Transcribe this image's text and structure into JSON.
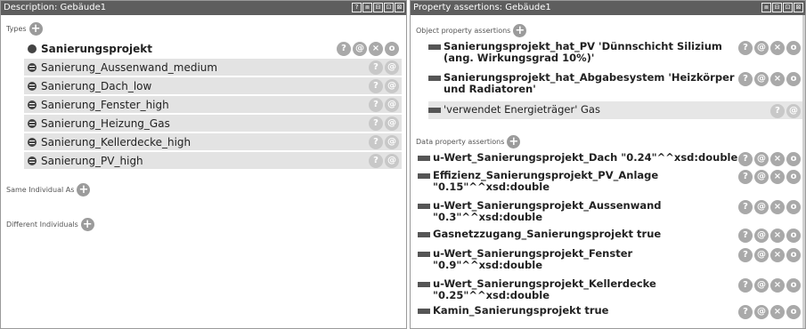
{
  "left": {
    "title": "Description: Gebäude1",
    "titlebar_buttons": [
      "?",
      "⧈",
      "⊟",
      "⊡",
      "⊠"
    ],
    "types_label": "Types",
    "types": [
      {
        "label": "Sanierungsprojekt",
        "kind": "dot",
        "bold": true
      },
      {
        "label": "Sanierung_Aussenwand_medium",
        "kind": "eq"
      },
      {
        "label": "Sanierung_Dach_low",
        "kind": "eq"
      },
      {
        "label": "Sanierung_Fenster_high",
        "kind": "eq"
      },
      {
        "label": "Sanierung_Heizung_Gas",
        "kind": "eq"
      },
      {
        "label": "Sanierung_Kellerdecke_high",
        "kind": "eq"
      },
      {
        "label": "Sanierung_PV_high",
        "kind": "eq"
      }
    ],
    "same_label": "Same Individual As",
    "different_label": "Different Individuals"
  },
  "right": {
    "title": "Property assertions: Gebäude1",
    "titlebar_buttons": [
      "⧈",
      "⊟",
      "⊡",
      "⊠"
    ],
    "object_label": "Object property assertions",
    "object_props": [
      {
        "line1": "Sanierungsprojekt_hat_PV  'Dünnschicht Silizium",
        "line2": "(ang. Wirkungsgrad 10%)'"
      },
      {
        "line1": "Sanierungsprojekt_hat_Abgabesystem  'Heizkörper",
        "line2": "und Radiatoren'"
      },
      {
        "line1": "'verwendet Energieträger'  Gas",
        "line2": ""
      }
    ],
    "data_label": "Data property assertions",
    "data_props": [
      {
        "line1": "u-Wert_Sanierungsprojekt_Dach  \"0.24\"^^xsd:double",
        "line2": ""
      },
      {
        "line1": "Effizienz_Sanierungsprojekt_PV_Anlage",
        "line2": "\"0.15\"^^xsd:double"
      },
      {
        "line1": "u-Wert_Sanierungsprojekt_Aussenwand",
        "line2": "\"0.3\"^^xsd:double"
      },
      {
        "line1": "Gasnetzzugang_Sanierungsprojekt  true",
        "line2": ""
      },
      {
        "line1": "u-Wert_Sanierungsprojekt_Fenster",
        "line2": "\"0.9\"^^xsd:double"
      },
      {
        "line1": "u-Wert_Sanierungsprojekt_Kellerdecke",
        "line2": "\"0.25\"^^xsd:double"
      },
      {
        "line1": "Kamin_Sanierungsprojekt  true",
        "line2": ""
      }
    ]
  },
  "icons": {
    "help": "?",
    "at": "@",
    "delete": "×",
    "edit": "o",
    "add": "+"
  }
}
